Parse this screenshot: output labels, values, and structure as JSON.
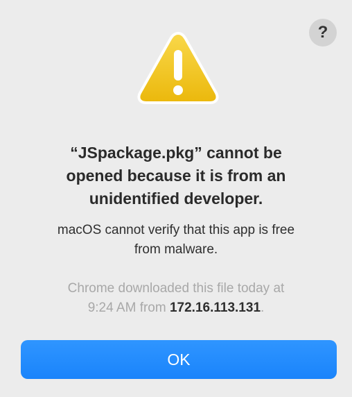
{
  "help_button": {
    "label": "?"
  },
  "icon": {
    "name": "warning-icon",
    "color": "#f3c623",
    "symbol": "!"
  },
  "title": {
    "line1": "“JSpackage.pkg” cannot be",
    "line2": "opened because it is from an",
    "line3": "unidentified developer."
  },
  "message": {
    "line1": "macOS cannot verify that this app is free",
    "line2": "from malware."
  },
  "info": {
    "line1": "Chrome downloaded this file today at",
    "line2_prefix": "9:24 AM from ",
    "ip": "172.16.113.131",
    "line2_suffix": "."
  },
  "ok_button": {
    "label": "OK",
    "color": "#1a84fb"
  }
}
